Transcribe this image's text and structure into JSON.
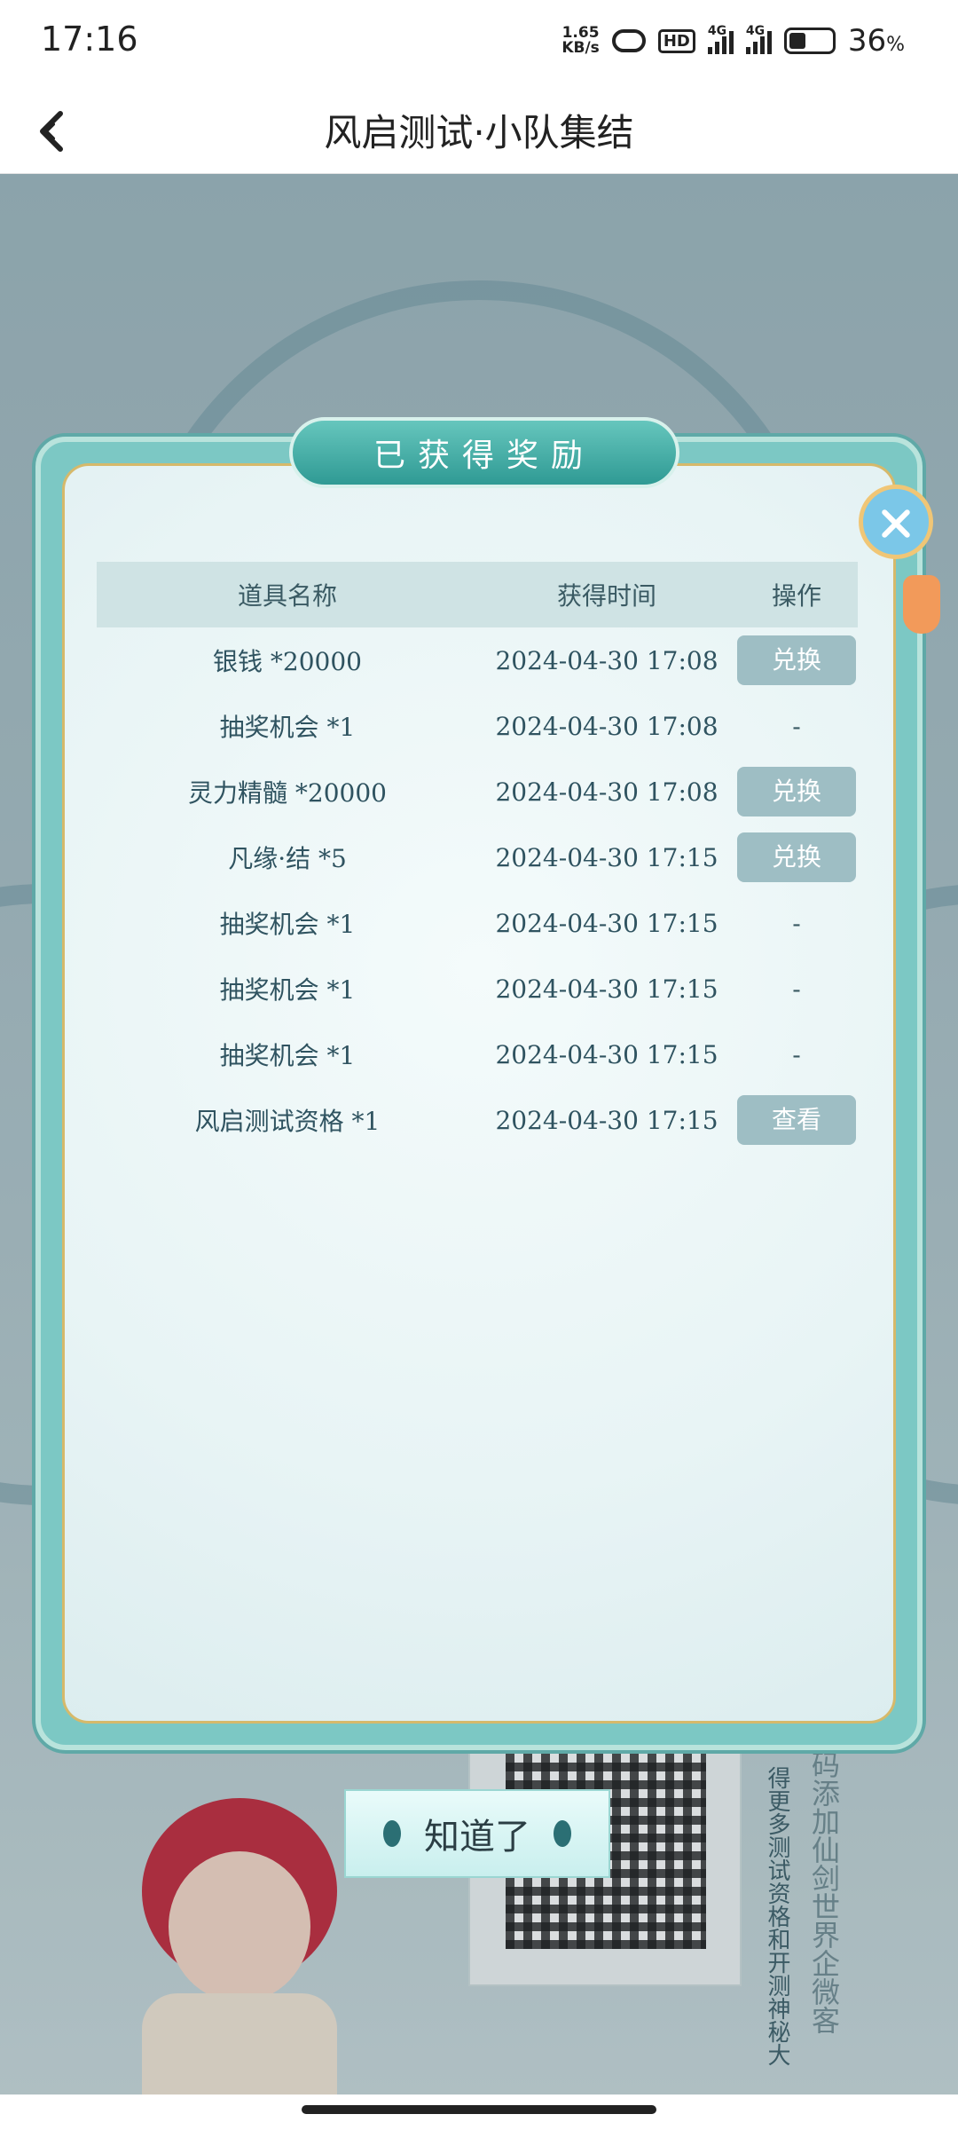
{
  "status_bar": {
    "time": "17:16",
    "net_speed_value": "1.65",
    "net_speed_unit": "KB/s",
    "hd_label": "HD",
    "signal1_label": "4G",
    "signal2_label": "4G",
    "battery_pct": "36",
    "battery_unit": "%"
  },
  "header": {
    "title": "风启测试·小队集结",
    "back_icon": "back-chevron-icon"
  },
  "modal": {
    "ribbon_title": "已获得奖励",
    "columns": [
      "道具名称",
      "获得时间",
      "操作"
    ],
    "rows": [
      {
        "name": "银钱 *20000",
        "time": "2024-04-30 17:08",
        "action": "兑换",
        "has_button": true
      },
      {
        "name": "抽奖机会 *1",
        "time": "2024-04-30 17:08",
        "action": "-",
        "has_button": false
      },
      {
        "name": "灵力精髓 *20000",
        "time": "2024-04-30 17:08",
        "action": "兑换",
        "has_button": true
      },
      {
        "name": "凡缘·结 *5",
        "time": "2024-04-30 17:15",
        "action": "兑换",
        "has_button": true
      },
      {
        "name": "抽奖机会 *1",
        "time": "2024-04-30 17:15",
        "action": "-",
        "has_button": false
      },
      {
        "name": "抽奖机会 *1",
        "time": "2024-04-30 17:15",
        "action": "-",
        "has_button": false
      },
      {
        "name": "抽奖机会 *1",
        "time": "2024-04-30 17:15",
        "action": "-",
        "has_button": false
      },
      {
        "name": "风启测试资格 *1",
        "time": "2024-04-30 17:15",
        "action": "查看",
        "has_button": true
      }
    ],
    "confirm_label": "知道了"
  },
  "background": {
    "vertical_text_1": "得更多测试资格和开测神秘大",
    "vertical_text_2": "扫码添加仙剑世界企微客"
  }
}
